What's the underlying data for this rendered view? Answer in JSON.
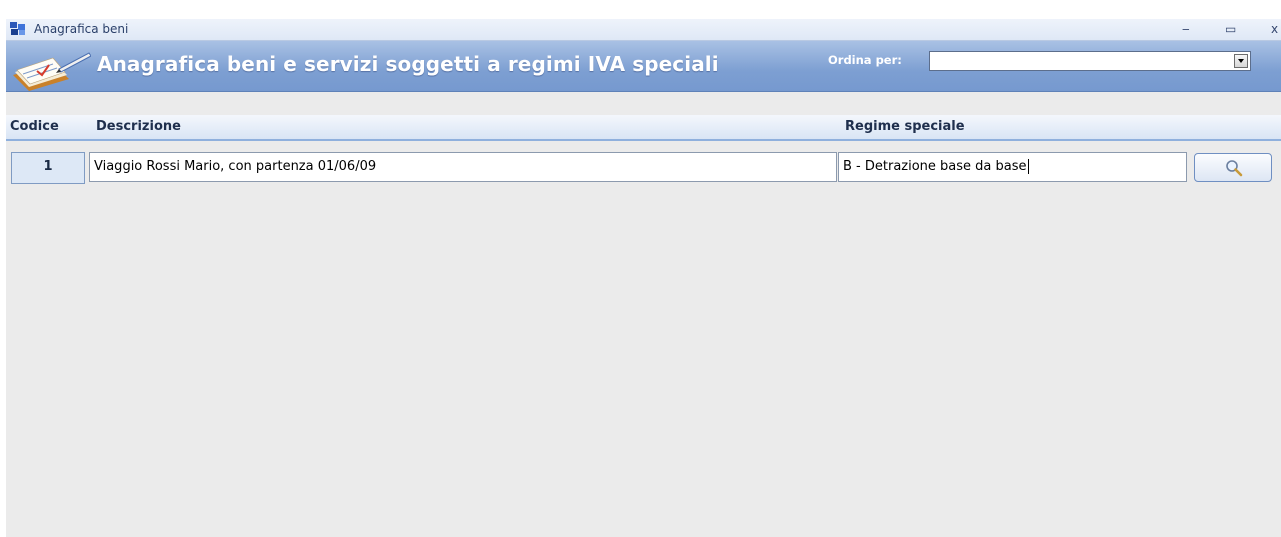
{
  "window": {
    "title": "Anagrafica beni",
    "controls": {
      "minimize": "‒",
      "maximize": "▭",
      "close": "x"
    }
  },
  "header": {
    "title": "Anagrafica beni e servizi soggetti a regimi IVA speciali",
    "sort_label": "Ordina per:",
    "sort_value": ""
  },
  "columns": {
    "codice": "Codice",
    "descrizione": "Descrizione",
    "regime": "Regime speciale"
  },
  "rows": [
    {
      "codice": "1",
      "descrizione": "Viaggio Rossi Mario, con partenza 01/06/09",
      "regime": "B - Detrazione base da base"
    }
  ],
  "colors": {
    "header_band": "#7d9fd2",
    "background": "#ebebeb",
    "column_header": "#d9e5f5"
  }
}
